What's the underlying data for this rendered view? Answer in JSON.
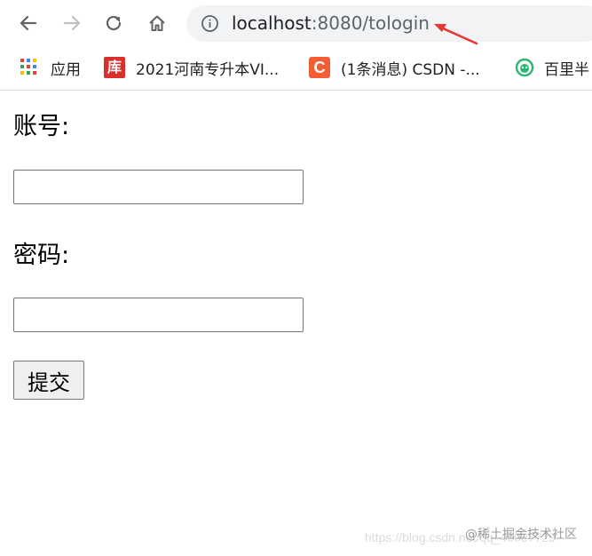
{
  "browser": {
    "address_bar": {
      "host": "localhost",
      "path": ":8080/tologin"
    },
    "icons": {
      "back": "back-arrow-icon",
      "forward": "forward-arrow-icon",
      "reload": "reload-icon",
      "home": "home-icon",
      "info": "info-icon"
    },
    "bookmarks": [
      {
        "label": "应用",
        "icon": "apps-grid-icon"
      },
      {
        "label": "2021河南专升本VI...",
        "icon": "ku-icon",
        "badge": "库"
      },
      {
        "label": "(1条消息) CSDN -...",
        "icon": "csdn-icon",
        "badge": "C"
      },
      {
        "label": "百里半",
        "icon": "baili-icon"
      }
    ]
  },
  "form": {
    "account_label": "账号:",
    "account_value": "",
    "password_label": "密码:",
    "password_value": "",
    "submit_label": "提交"
  },
  "watermarks": {
    "url_text": "https://blog.csdn.net/qq_40037729",
    "juejin_text": "@稀土掘金技术社区"
  },
  "colors": {
    "accent_arrow": "#e53935",
    "ku_badge": "#d9302c",
    "csdn_badge": "#f25d34",
    "baili_icon": "#2bb673"
  }
}
